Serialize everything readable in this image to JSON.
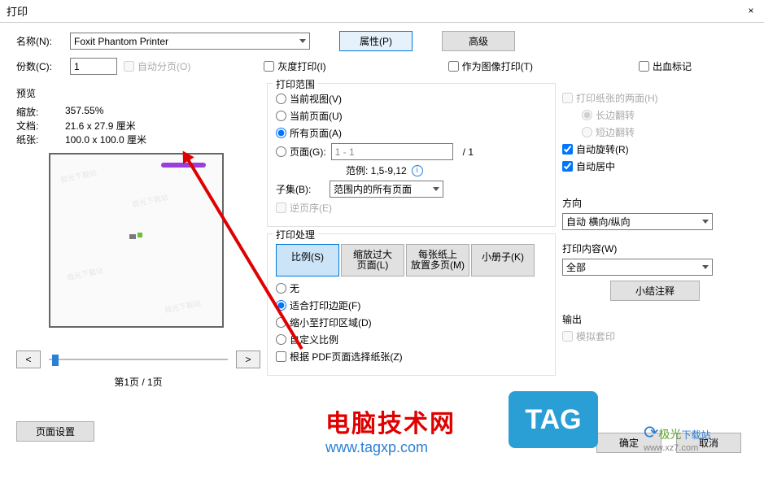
{
  "titlebar": {
    "title": "打印",
    "close": "×"
  },
  "header": {
    "name_label": "名称(N):",
    "printer": "Foxit Phantom Printer",
    "properties_btn": "属性(P)",
    "advanced_btn": "高级",
    "copies_label": "份数(C):",
    "copies_value": "1",
    "collate_label": "自动分页(O)",
    "grayscale_label": "灰度打印(I)",
    "as_image_label": "作为图像打印(T)",
    "bleed_label": "出血标记"
  },
  "preview": {
    "title": "预览",
    "zoom_lbl": "缩放:",
    "zoom_val": "357.55%",
    "doc_lbl": "文档:",
    "doc_val": "21.6 x 27.9 厘米",
    "paper_lbl": "纸张:",
    "paper_val": "100.0 x 100.0 厘米",
    "prev": "<",
    "next": ">",
    "page_ind": "第1页 / 1页",
    "page_setup_btn": "页面设置"
  },
  "range": {
    "title": "打印范围",
    "current_view": "当前视图(V)",
    "current_page": "当前页面(U)",
    "all_pages": "所有页面(A)",
    "pages": "页面(G):",
    "pages_val": "1 - 1",
    "page_total": "/ 1",
    "example": "范例: 1,5-9,12",
    "subset_lbl": "子集(B):",
    "subset_val": "范围内的所有页面",
    "reverse": "逆页序(E)"
  },
  "handle": {
    "title": "打印处理",
    "scale": "比例(S)",
    "fit": "缩放过大\n页面(L)",
    "tile": "每张纸上\n放置多页(M)",
    "booklet": "小册子(K)",
    "none": "无",
    "fit_margins": "适合打印边距(F)",
    "shrink": "缩小至打印区域(D)",
    "custom": "自定义比例",
    "by_pdf_size": "根据 PDF页面选择纸张(Z)"
  },
  "right": {
    "duplex": "打印纸张的两面(H)",
    "long_edge": "长边翻转",
    "short_edge": "短边翻转",
    "auto_rotate": "自动旋转(R)",
    "auto_center": "自动居中",
    "orient_title": "方向",
    "orient_val": "自动 横向/纵向",
    "content_title": "打印内容(W)",
    "content_val": "全部",
    "summary_btn": "小结注释",
    "output_title": "输出",
    "simulate": "模拟套印"
  },
  "buttons": {
    "ok": "确定",
    "cancel": "取消"
  },
  "watermark": {
    "cn": "电脑技术网",
    "url": "www.tagxp.com",
    "tag": "TAG",
    "site_green": "极光",
    "site_cn": "下载站",
    "site_url": "www.xz7.com"
  }
}
